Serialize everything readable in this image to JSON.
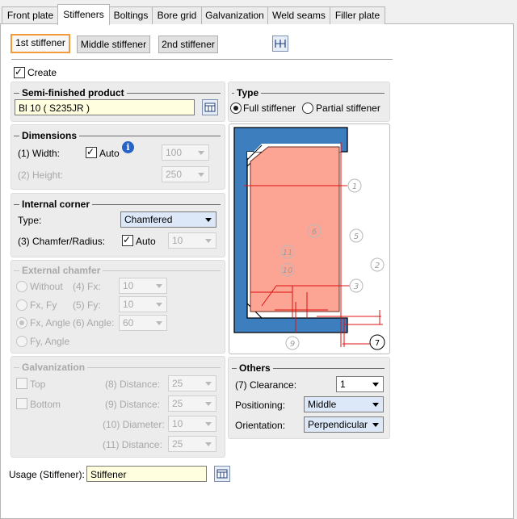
{
  "tabs": [
    {
      "label": "Front plate"
    },
    {
      "label": "Stiffeners"
    },
    {
      "label": "Boltings"
    },
    {
      "label": "Bore grid"
    },
    {
      "label": "Galvanization"
    },
    {
      "label": "Weld seams"
    },
    {
      "label": "Filler plate"
    }
  ],
  "stiffener_buttons": {
    "first": "1st stiffener",
    "middle": "Middle stiffener",
    "second": "2nd stiffener"
  },
  "create": {
    "label": "Create",
    "checked": true
  },
  "semi_finished": {
    "title": "Semi-finished product",
    "value": "Bl 10  ( S235JR )"
  },
  "type": {
    "title": "Type",
    "full": "Full stiffener",
    "partial": "Partial stiffener",
    "selected": "full"
  },
  "dimensions": {
    "title": "Dimensions",
    "width_label": "(1) Width:",
    "auto_label": "Auto",
    "width_value": "100",
    "height_label": "(2) Height:",
    "height_value": "250"
  },
  "internal_corner": {
    "title": "Internal corner",
    "type_label": "Type:",
    "type_value": "Chamfered",
    "chamfer_label": "(3) Chamfer/Radius:",
    "auto_label": "Auto",
    "chamfer_value": "10"
  },
  "external_chamfer": {
    "title": "External chamfer",
    "without": "Without",
    "fxfy": "Fx, Fy",
    "fxangle": "Fx, Angle",
    "fyangle": "Fy, Angle",
    "fx_label": "(4) Fx:",
    "fx_value": "10",
    "fy_label": "(5) Fy:",
    "fy_value": "10",
    "angle_label": "(6) Angle:",
    "angle_value": "60"
  },
  "galvanization": {
    "title": "Galvanization",
    "top": "Top",
    "bottom": "Bottom",
    "d8_label": "(8) Distance:",
    "d8_value": "25",
    "d9_label": "(9) Distance:",
    "d9_value": "25",
    "d10_label": "(10) Diameter:",
    "d10_value": "10",
    "d11_label": "(11) Distance:",
    "d11_value": "25"
  },
  "diagram_labels": [
    "1",
    "2",
    "3",
    "5",
    "6",
    "7",
    "9",
    "10",
    "11"
  ],
  "others": {
    "title": "Others",
    "clearance_label": "(7) Clearance:",
    "clearance_value": "1",
    "positioning_label": "Positioning:",
    "positioning_value": "Middle",
    "orientation_label": "Orientation:",
    "orientation_value": "Perpendicular"
  },
  "usage": {
    "label": "Usage (Stiffener):",
    "value": "Stiffener"
  },
  "colors": {
    "selected_border": "#f29b3a",
    "profile_blue": "#3d7ebf",
    "stiffener_fill": "#fca595",
    "dim_red": "#e01010"
  }
}
